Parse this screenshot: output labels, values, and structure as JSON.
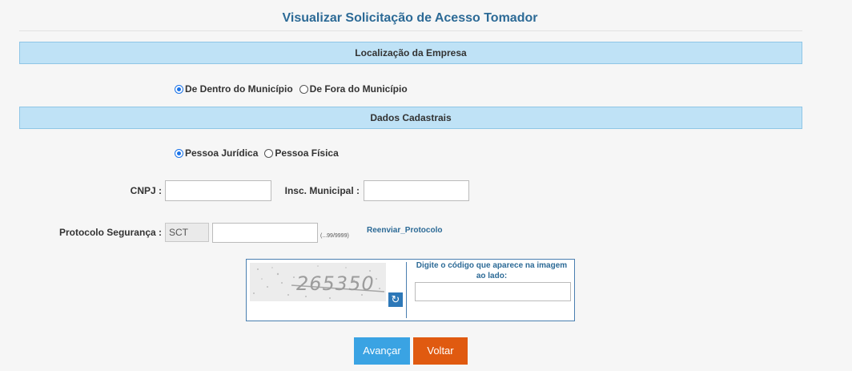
{
  "page": {
    "title": "Visualizar Solicitação de Acesso Tomador"
  },
  "sections": {
    "location": "Localização da Empresa",
    "registration": "Dados Cadastrais"
  },
  "location_options": [
    {
      "label": "De Dentro do Município",
      "checked": true
    },
    {
      "label": "De Fora do Município",
      "checked": false
    }
  ],
  "person_options": [
    {
      "label": "Pessoa Jurídica",
      "checked": true
    },
    {
      "label": "Pessoa Física",
      "checked": false
    }
  ],
  "fields": {
    "cnpj_label": "CNPJ :",
    "cnpj_value": "",
    "insc_label": "Insc. Municipal :",
    "insc_value": "",
    "protocolo_label": "Protocolo Segurança :",
    "protocolo_prefix": "SCT",
    "protocolo_value": "",
    "protocolo_hint": "(...99/9999)",
    "resend_link": "Reenviar_Protocolo"
  },
  "captcha": {
    "code": "265350",
    "instruction": "Digite o código que aparece na imagem ao lado:",
    "input_value": "",
    "refresh_icon": "refresh-icon"
  },
  "buttons": {
    "next": "Avançar",
    "back": "Voltar"
  },
  "colors": {
    "title": "#2c6a96",
    "section_bar": "#bfe2f6",
    "next_button": "#3aa3e3",
    "back_button": "#e05a10"
  }
}
